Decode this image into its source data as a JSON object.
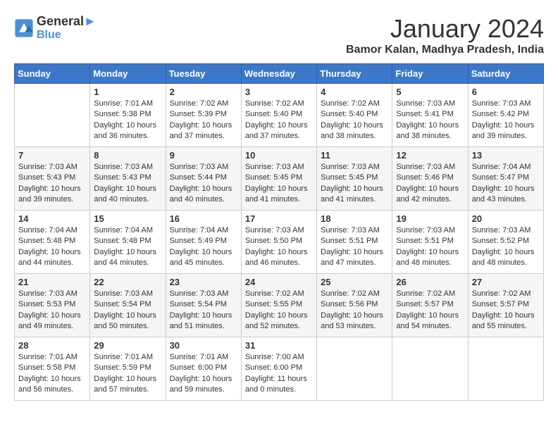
{
  "logo": {
    "line1": "General",
    "line2": "Blue"
  },
  "title": "January 2024",
  "location": "Bamor Kalan, Madhya Pradesh, India",
  "days_of_week": [
    "Sunday",
    "Monday",
    "Tuesday",
    "Wednesday",
    "Thursday",
    "Friday",
    "Saturday"
  ],
  "weeks": [
    [
      {
        "day": "",
        "info": ""
      },
      {
        "day": "1",
        "info": "Sunrise: 7:01 AM\nSunset: 5:38 PM\nDaylight: 10 hours\nand 36 minutes."
      },
      {
        "day": "2",
        "info": "Sunrise: 7:02 AM\nSunset: 5:39 PM\nDaylight: 10 hours\nand 37 minutes."
      },
      {
        "day": "3",
        "info": "Sunrise: 7:02 AM\nSunset: 5:40 PM\nDaylight: 10 hours\nand 37 minutes."
      },
      {
        "day": "4",
        "info": "Sunrise: 7:02 AM\nSunset: 5:40 PM\nDaylight: 10 hours\nand 38 minutes."
      },
      {
        "day": "5",
        "info": "Sunrise: 7:03 AM\nSunset: 5:41 PM\nDaylight: 10 hours\nand 38 minutes."
      },
      {
        "day": "6",
        "info": "Sunrise: 7:03 AM\nSunset: 5:42 PM\nDaylight: 10 hours\nand 39 minutes."
      }
    ],
    [
      {
        "day": "7",
        "info": "Sunrise: 7:03 AM\nSunset: 5:43 PM\nDaylight: 10 hours\nand 39 minutes."
      },
      {
        "day": "8",
        "info": "Sunrise: 7:03 AM\nSunset: 5:43 PM\nDaylight: 10 hours\nand 40 minutes."
      },
      {
        "day": "9",
        "info": "Sunrise: 7:03 AM\nSunset: 5:44 PM\nDaylight: 10 hours\nand 40 minutes."
      },
      {
        "day": "10",
        "info": "Sunrise: 7:03 AM\nSunset: 5:45 PM\nDaylight: 10 hours\nand 41 minutes."
      },
      {
        "day": "11",
        "info": "Sunrise: 7:03 AM\nSunset: 5:45 PM\nDaylight: 10 hours\nand 41 minutes."
      },
      {
        "day": "12",
        "info": "Sunrise: 7:03 AM\nSunset: 5:46 PM\nDaylight: 10 hours\nand 42 minutes."
      },
      {
        "day": "13",
        "info": "Sunrise: 7:04 AM\nSunset: 5:47 PM\nDaylight: 10 hours\nand 43 minutes."
      }
    ],
    [
      {
        "day": "14",
        "info": "Sunrise: 7:04 AM\nSunset: 5:48 PM\nDaylight: 10 hours\nand 44 minutes."
      },
      {
        "day": "15",
        "info": "Sunrise: 7:04 AM\nSunset: 5:48 PM\nDaylight: 10 hours\nand 44 minutes."
      },
      {
        "day": "16",
        "info": "Sunrise: 7:04 AM\nSunset: 5:49 PM\nDaylight: 10 hours\nand 45 minutes."
      },
      {
        "day": "17",
        "info": "Sunrise: 7:03 AM\nSunset: 5:50 PM\nDaylight: 10 hours\nand 46 minutes."
      },
      {
        "day": "18",
        "info": "Sunrise: 7:03 AM\nSunset: 5:51 PM\nDaylight: 10 hours\nand 47 minutes."
      },
      {
        "day": "19",
        "info": "Sunrise: 7:03 AM\nSunset: 5:51 PM\nDaylight: 10 hours\nand 48 minutes."
      },
      {
        "day": "20",
        "info": "Sunrise: 7:03 AM\nSunset: 5:52 PM\nDaylight: 10 hours\nand 48 minutes."
      }
    ],
    [
      {
        "day": "21",
        "info": "Sunrise: 7:03 AM\nSunset: 5:53 PM\nDaylight: 10 hours\nand 49 minutes."
      },
      {
        "day": "22",
        "info": "Sunrise: 7:03 AM\nSunset: 5:54 PM\nDaylight: 10 hours\nand 50 minutes."
      },
      {
        "day": "23",
        "info": "Sunrise: 7:03 AM\nSunset: 5:54 PM\nDaylight: 10 hours\nand 51 minutes."
      },
      {
        "day": "24",
        "info": "Sunrise: 7:02 AM\nSunset: 5:55 PM\nDaylight: 10 hours\nand 52 minutes."
      },
      {
        "day": "25",
        "info": "Sunrise: 7:02 AM\nSunset: 5:56 PM\nDaylight: 10 hours\nand 53 minutes."
      },
      {
        "day": "26",
        "info": "Sunrise: 7:02 AM\nSunset: 5:57 PM\nDaylight: 10 hours\nand 54 minutes."
      },
      {
        "day": "27",
        "info": "Sunrise: 7:02 AM\nSunset: 5:57 PM\nDaylight: 10 hours\nand 55 minutes."
      }
    ],
    [
      {
        "day": "28",
        "info": "Sunrise: 7:01 AM\nSunset: 5:58 PM\nDaylight: 10 hours\nand 56 minutes."
      },
      {
        "day": "29",
        "info": "Sunrise: 7:01 AM\nSunset: 5:59 PM\nDaylight: 10 hours\nand 57 minutes."
      },
      {
        "day": "30",
        "info": "Sunrise: 7:01 AM\nSunset: 6:00 PM\nDaylight: 10 hours\nand 59 minutes."
      },
      {
        "day": "31",
        "info": "Sunrise: 7:00 AM\nSunset: 6:00 PM\nDaylight: 11 hours\nand 0 minutes."
      },
      {
        "day": "",
        "info": ""
      },
      {
        "day": "",
        "info": ""
      },
      {
        "day": "",
        "info": ""
      }
    ]
  ]
}
